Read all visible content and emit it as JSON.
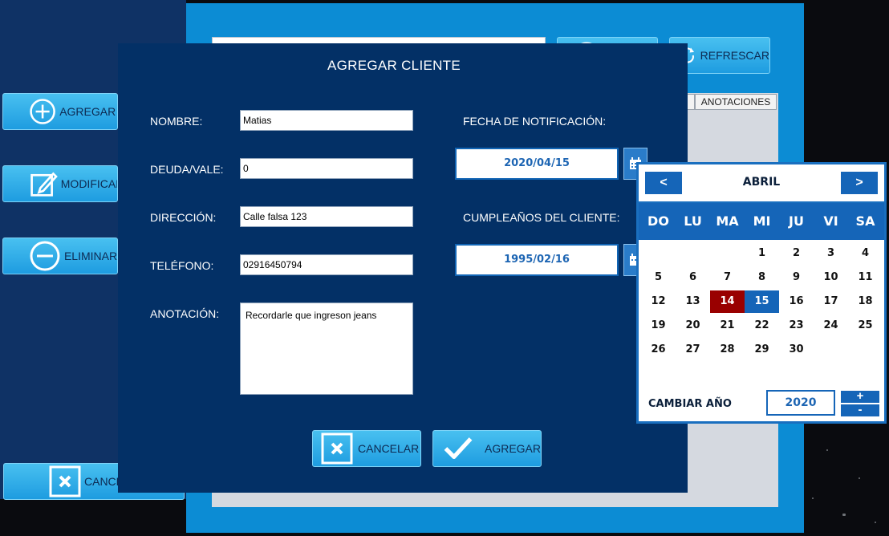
{
  "sidebar": {
    "add_label": "AGREGAR C",
    "modify_label": "MODIFICAR",
    "delete_label": "ELIMINAR",
    "cancel_label": "CANCE"
  },
  "toolbar": {
    "refresh_label": "REFRESCAR"
  },
  "table": {
    "columns": [
      "ANOTACIONES"
    ]
  },
  "dialog": {
    "title": "AGREGAR CLIENTE",
    "name_label": "NOMBRE:",
    "name_value": "Matias",
    "debt_label": "DEUDA/VALE:",
    "debt_value": "0",
    "address_label": "DIRECCIÓN:",
    "address_value": "Calle falsa 123",
    "phone_label": "TELÉFONO:",
    "phone_value": "02916450794",
    "note_label": "ANOTACIÓN:",
    "note_value": "Recordarle que ingreson jeans",
    "notify_label": "FECHA DE NOTIFICACIÓN:",
    "notify_date": "2020/04/15",
    "birthday_label": "CUMPLEAÑOS DEL CLIENTE:",
    "birthday_date": "1995/02/16",
    "cancel_label": "CANCELAR",
    "add_label": "AGREGAR"
  },
  "calendar": {
    "prev": "<",
    "next": ">",
    "month": "ABRIL",
    "weekdays": [
      "DO",
      "LU",
      "MA",
      "MI",
      "JU",
      "VI",
      "SA"
    ],
    "first_weekday_index": 3,
    "days_in_month": 30,
    "today": 14,
    "selected": 15,
    "year_label": "CAMBIAR AÑO",
    "year": "2020",
    "year_plus": "+",
    "year_minus": "-"
  },
  "colors": {
    "dialog_bg": "#033066",
    "accent": "#1565b8",
    "today": "#990000",
    "button": "#2aa8ea"
  }
}
